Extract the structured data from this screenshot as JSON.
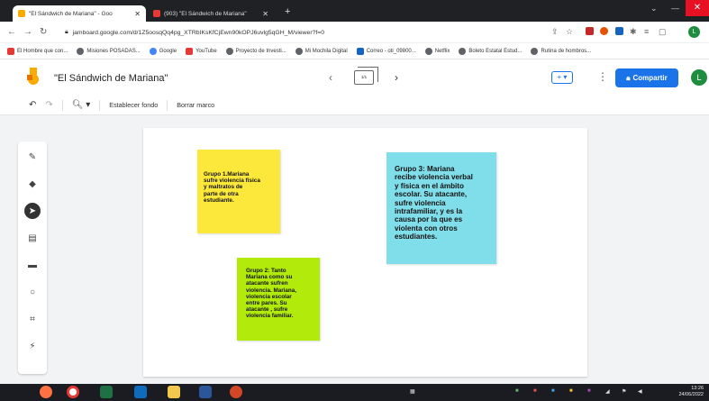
{
  "browser": {
    "tabs": [
      {
        "title": "\"El Sándwich de Mariana\" - Goo",
        "active": true
      },
      {
        "title": "(903) \"El Sándwich de Mariana\"",
        "active": false
      }
    ],
    "new_tab": "+",
    "url": "jamboard.google.com/d/1Z5oosqQq4pg_XTRbIKsKfCjEwn90kOPJ6uvlg5qGH_M/viewer?f=0",
    "profile_initial": "L"
  },
  "bookmarks": [
    {
      "label": "El Hombre que con...",
      "color": "#e53935"
    },
    {
      "label": "Misiones POSADAS...",
      "color": "#5f6368"
    },
    {
      "label": "Google",
      "color": "#4285f4"
    },
    {
      "label": "YouTube",
      "color": "#e53935"
    },
    {
      "label": "Proyecto de Investi...",
      "color": "#5f6368"
    },
    {
      "label": "Mi Mochila Digital",
      "color": "#5f6368"
    },
    {
      "label": "Correo - oti_09800...",
      "color": "#1565c0"
    },
    {
      "label": "Netflix",
      "color": "#5f6368"
    },
    {
      "label": "Boleto Estatal Estud...",
      "color": "#5f6368"
    },
    {
      "label": "Rutina de hombros...",
      "color": "#5f6368"
    }
  ],
  "app": {
    "title": "\"El Sándwich de Mariana\"",
    "frame_counter": "1/1",
    "share_label": "Compartir",
    "user_initial": "L",
    "accent": "#1a73e8"
  },
  "toolbar": {
    "zoom_icon": "zoom-icon",
    "set_background": "Establecer fondo",
    "clear_frame": "Borrar marco"
  },
  "tools": [
    "pen-icon",
    "eraser-icon",
    "select-icon",
    "sticky-note-icon",
    "image-icon",
    "circle-icon",
    "text-box-icon",
    "laser-icon"
  ],
  "notes": [
    {
      "color": "#fce83a",
      "text": "Grupo 1.Mariana\nsufre violencia física\n y  maltratos de\nparte de otra\nestudiante."
    },
    {
      "color": "#80deea",
      "text": "Grupo 3: Mariana\nrecibe violencia verbal\ny física en el ámbito\nescolar. Su atacante,\nsufre violencia\nintrafamiliar, y es la\ncausa por la que es\nviolenta con otros\nestudiantes."
    },
    {
      "color": "#b2ea0b",
      "text": "Grupo 2: Tanto\nMariana como su\natacante sufren\nviolencia. Mariana,\nviolencia escolar\nentre pares. Su\natacante , sufre\nviolencia familiar."
    }
  ],
  "taskbar": {
    "time": "13:26",
    "date": "24/06/2022"
  }
}
